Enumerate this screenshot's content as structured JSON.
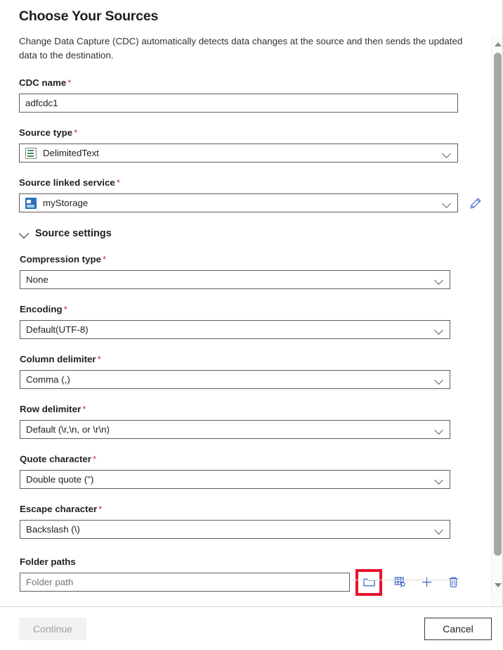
{
  "header": {
    "title": "Choose Your Sources",
    "description": "Change Data Capture (CDC) automatically detects data changes at the source and then sends the updated data to the destination."
  },
  "required_marker": "*",
  "fields": {
    "cdc_name": {
      "label": "CDC name",
      "value": "adfcdc1",
      "required": true
    },
    "source_type": {
      "label": "Source type",
      "value": "DelimitedText",
      "icon": "delimited-text-icon",
      "required": true
    },
    "source_linked_service": {
      "label": "Source linked service",
      "value": "myStorage",
      "icon": "storage-account-icon",
      "edit_icon": "pencil-icon",
      "required": true
    }
  },
  "source_settings": {
    "title": "Source settings",
    "expanded": true,
    "chevron": "chevron-down-icon",
    "fields": [
      {
        "label": "Compression type",
        "value": "None",
        "required": true
      },
      {
        "label": "Encoding",
        "value": "Default(UTF-8)",
        "required": true
      },
      {
        "label": "Column delimiter",
        "value": "Comma (,)",
        "required": true
      },
      {
        "label": "Row delimiter",
        "value": "Default (\\r,\\n, or \\r\\n)",
        "required": true
      },
      {
        "label": "Quote character",
        "value": "Double quote (\")",
        "required": true
      },
      {
        "label": "Escape character",
        "value": "Backslash (\\)",
        "required": true
      }
    ]
  },
  "folder_paths": {
    "label": "Folder paths",
    "input_value": "",
    "input_placeholder": "Folder path",
    "actions": [
      {
        "name": "browse-folder-button",
        "icon": "folder-icon",
        "highlighted": true
      },
      {
        "name": "preview-data-button",
        "icon": "grid-search-icon",
        "highlighted": false
      },
      {
        "name": "add-folder-path-button",
        "icon": "plus-icon",
        "highlighted": false
      },
      {
        "name": "delete-folder-path-button",
        "icon": "trash-icon",
        "highlighted": false
      }
    ]
  },
  "footer": {
    "continue_label": "Continue",
    "continue_disabled": true,
    "cancel_label": "Cancel"
  },
  "scrollbar": {
    "up_icon": "scroll-up-arrow-icon",
    "down_icon": "scroll-down-arrow-icon"
  },
  "colors": {
    "required_asterisk": "#c4314b",
    "highlight_box": "#e8112d",
    "icon_blue": "#2b579a",
    "border": "#605e5c"
  }
}
